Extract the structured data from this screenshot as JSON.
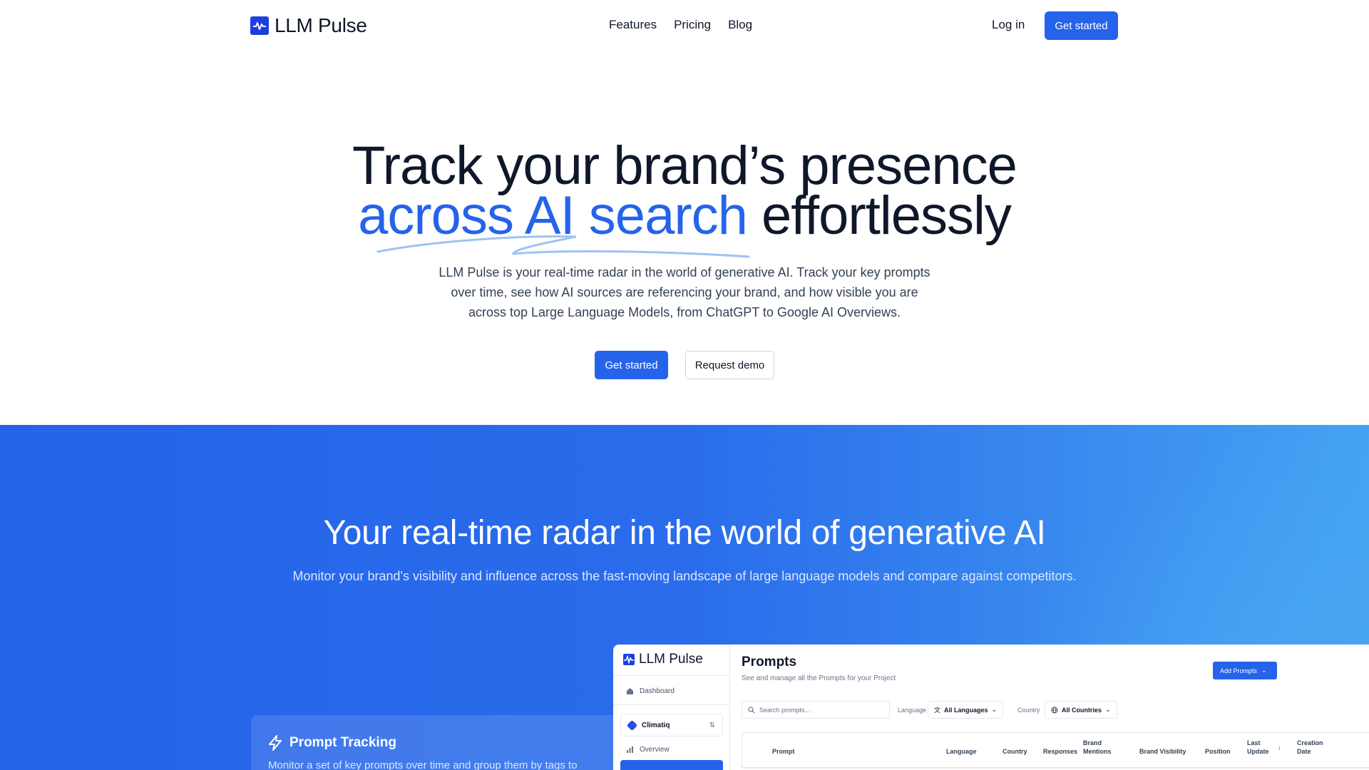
{
  "nav": {
    "brand": "LLM Pulse",
    "links": [
      "Features",
      "Pricing",
      "Blog"
    ],
    "login": "Log in",
    "cta": "Get started"
  },
  "hero": {
    "title_line1": "Track your brand’s presence",
    "title_accent": "across AI search",
    "title_rest": " effortlessly",
    "subtitle": "LLM Pulse is your real-time radar in the world of generative AI. Track your key prompts over time, see how AI sources are referencing your brand, and how visible you are across top Large Language Models, from ChatGPT to Google AI Overviews.",
    "primary_button": "Get started",
    "secondary_button": "Request demo"
  },
  "section": {
    "title": "Your real-time radar in the world of generative AI",
    "subtitle": "Monitor your brand's visibility and influence across the fast-moving landscape of large language models and compare against competitors."
  },
  "feature": {
    "title": "Prompt Tracking",
    "description": "Monitor a set of key prompts over time and group them by tags to"
  },
  "app": {
    "brand": "LLM Pulse",
    "sidebar": {
      "dashboard": "Dashboard",
      "project": "Climatiq",
      "overview": "Overview"
    },
    "page_title": "Prompts",
    "page_subtitle": "See and manage all the Prompts for your Project",
    "add_button": "Add Prompts",
    "search_placeholder": "Search prompts...",
    "language_label": "Language",
    "language_value": "All Languages",
    "country_label": "Country",
    "country_value": "All Countries",
    "columns": {
      "prompt": "Prompt",
      "language": "Language",
      "country": "Country",
      "responses": "Responses",
      "brand_mentions_1": "Brand",
      "brand_mentions_2": "Mentions",
      "brand_visibility": "Brand Visibility",
      "position": "Position",
      "last_update_1": "Last",
      "last_update_2": "Update",
      "creation_date_1": "Creation",
      "creation_date_2": "Date"
    }
  },
  "colors": {
    "accent": "#2563eb",
    "text": "#0f172a",
    "section_bg": "#2a6ceb"
  }
}
